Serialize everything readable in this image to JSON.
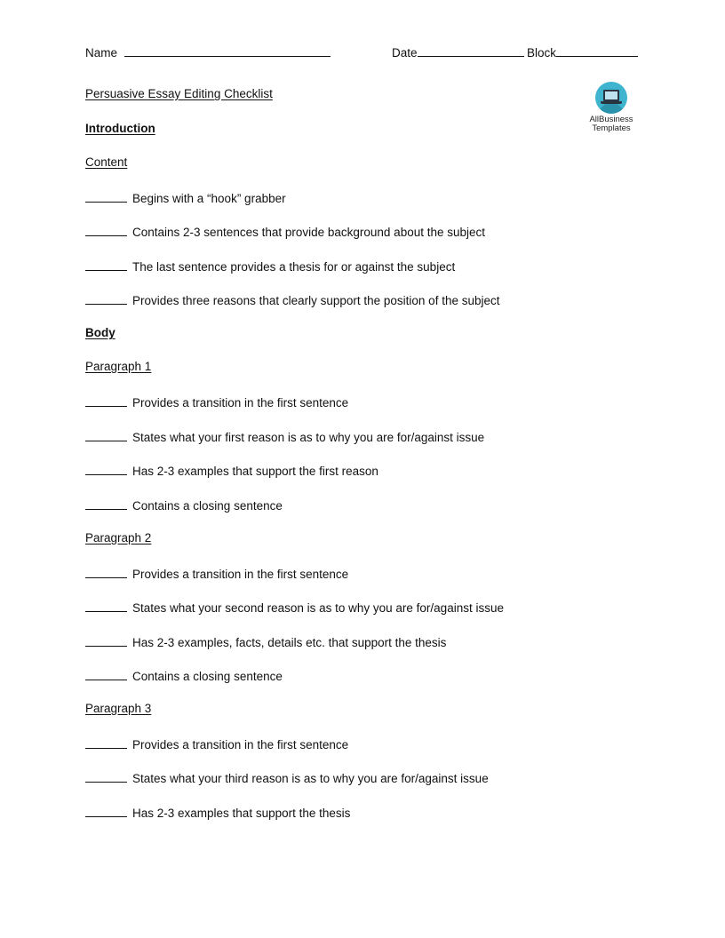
{
  "header": {
    "name_label": "Name",
    "date_label": "Date",
    "block_label": "Block"
  },
  "logo": {
    "icon": "laptop-icon",
    "line1": "AllBusiness",
    "line2": "Templates",
    "color": "#3fb4cf"
  },
  "title": "Persuasive Essay Editing Checklist",
  "sections": {
    "introduction": {
      "heading": "Introduction",
      "subheading": "Content",
      "items": [
        "Begins with a “hook” grabber",
        "Contains 2-3 sentences that provide background about the subject",
        "The last sentence provides a thesis for or against the subject",
        "Provides three reasons that clearly support the position of the subject"
      ]
    },
    "body": {
      "heading": "Body",
      "paragraph1": {
        "subheading": "Paragraph 1",
        "items": [
          "Provides a transition in the first sentence",
          "States what your first reason is as to why you are for/against issue",
          "Has 2-3 examples that support the first reason",
          "Contains a closing sentence"
        ]
      },
      "paragraph2": {
        "subheading": "Paragraph 2",
        "items": [
          "Provides a transition in the first sentence",
          "States what your second reason is as to why you are for/against issue",
          "Has 2-3 examples, facts, details etc. that support the thesis",
          "Contains a closing sentence"
        ]
      },
      "paragraph3": {
        "subheading": "Paragraph 3",
        "items": [
          "Provides a transition in the first sentence",
          "States what your third reason is as to why you are for/against issue",
          "Has 2-3 examples that support the thesis"
        ]
      }
    }
  }
}
